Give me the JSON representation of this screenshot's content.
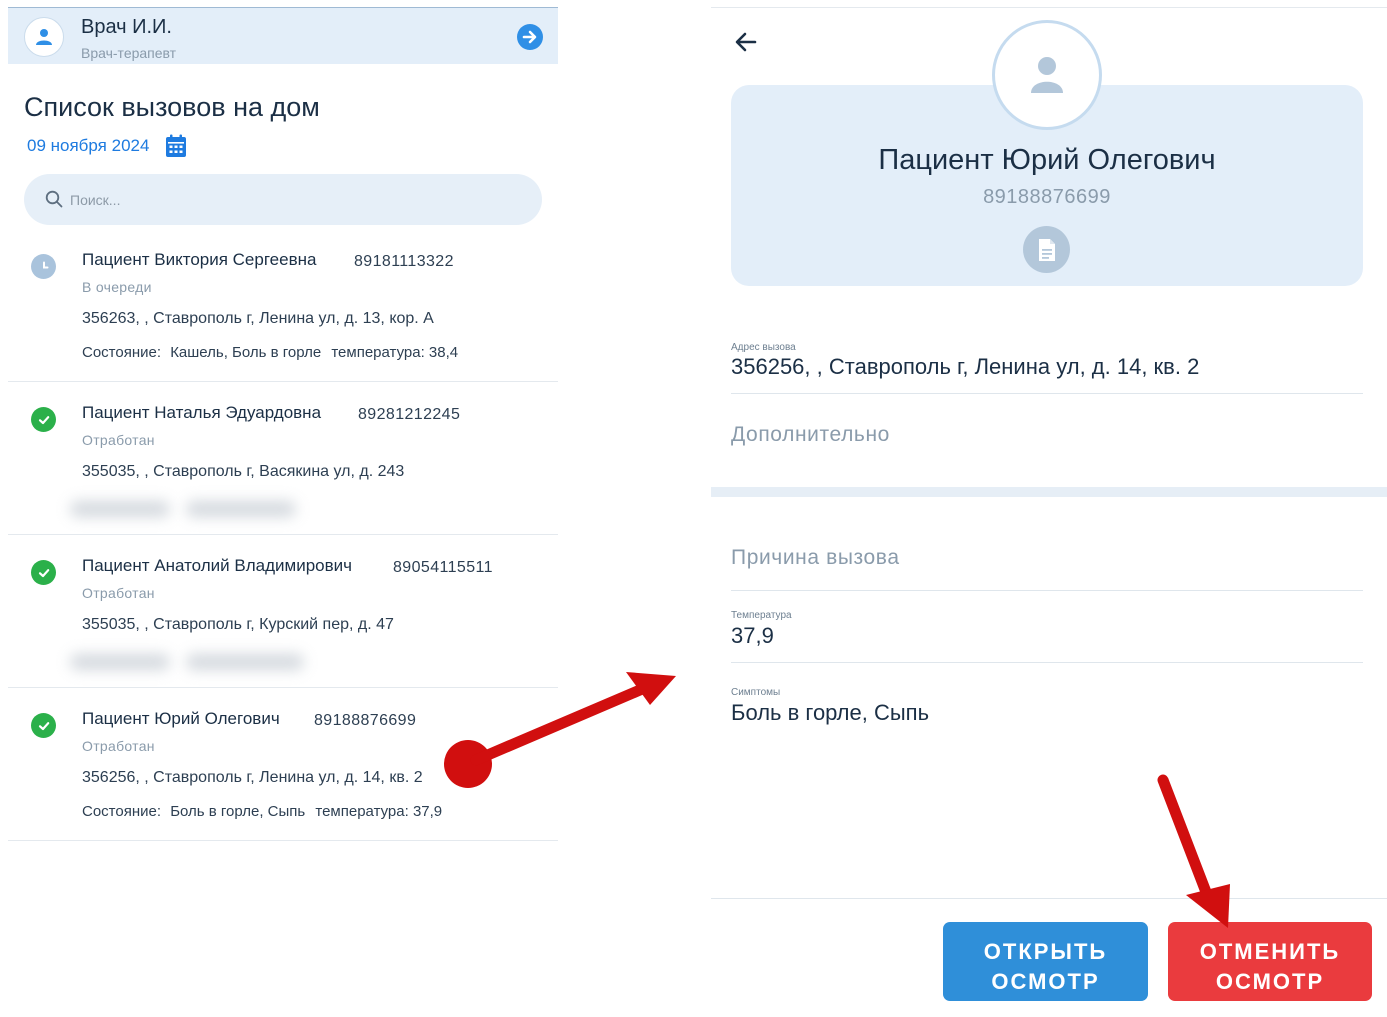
{
  "doctor": {
    "name": "Врач И.И.",
    "role": "Врач-терапевт"
  },
  "list": {
    "title": "Список вызовов на дом",
    "date": "09 ноября 2024",
    "search_placeholder": "Поиск..."
  },
  "patients": [
    {
      "name": "Пациент Виктория Сергеевна",
      "phone": "89181113322",
      "status": "В очереди",
      "address": "356263, , Ставрополь г, Ленина ул, д. 13, кор. А",
      "condition_label": "Состояние:",
      "condition": "Кашель, Боль в горле",
      "temperature": "температура: 38,4"
    },
    {
      "name": "Пациент Наталья Эдуардовна",
      "phone": "89281212245",
      "status": "Отработан",
      "address": "355035, , Ставрополь г, Васякина ул, д. 243"
    },
    {
      "name": "Пациент Анатолий Владимирович",
      "phone": "89054115511",
      "status": "Отработан",
      "address": "355035, , Ставрополь г, Курский пер, д. 47"
    },
    {
      "name": "Пациент Юрий Олегович",
      "phone": "89188876699",
      "status": "Отработан",
      "address": "356256, , Ставрополь г, Ленина ул, д. 14, кв. 2",
      "condition_label": "Состояние:",
      "condition": "Боль в горле, Сыпь",
      "temperature": "температура: 37,9"
    }
  ],
  "detail": {
    "patient_name": "Пациент Юрий Олегович",
    "phone": "89188876699",
    "address_label": "Адрес вызова",
    "address": "356256, , Ставрополь г, Ленина ул, д. 14, кв. 2",
    "additional_title": "Дополнительно",
    "reason_title": "Причина вызова",
    "temperature_label": "Температура",
    "temperature": "37,9",
    "symptoms_label": "Симптомы",
    "symptoms": "Боль в горле, Сыпь",
    "open_button": "ОТКРЫТЬ ОСМОТР",
    "cancel_button": "ОТМЕНИТЬ ОСМОТР"
  },
  "colors": {
    "accent": "#1e7be0",
    "success": "#2bb04a",
    "queue": "#a9c3dc",
    "open_button": "#2f8fd9",
    "cancel_button": "#ea3b3e",
    "annotation": "#d10f0f"
  }
}
